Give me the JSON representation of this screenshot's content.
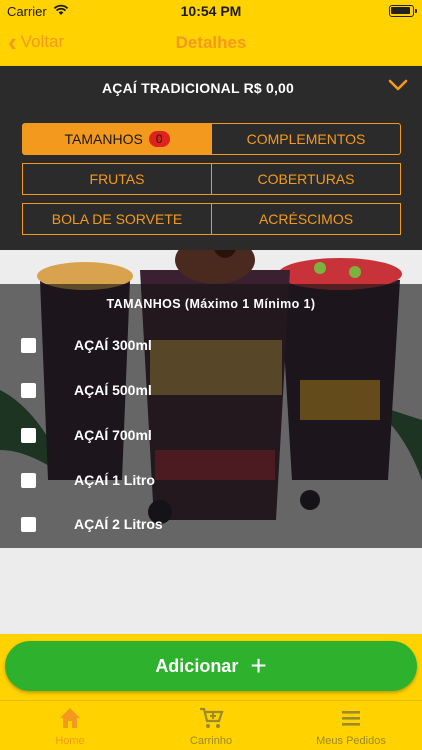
{
  "status": {
    "carrier": "Carrier",
    "time": "10:54 PM"
  },
  "nav": {
    "back_label": "Voltar",
    "title": "Detalhes"
  },
  "product": {
    "name": "AÇAÍ TRADICIONAL R$ 0,00"
  },
  "tabs": {
    "tamanhos": "TAMANHOS",
    "tamanhos_badge": "0",
    "complementos": "COMPLEMENTOS",
    "frutas": "FRUTAS",
    "coberturas": "COBERTURAS",
    "bola_de_sorvete": "BOLA DE SORVETE",
    "acrescimos": "ACRÉSCIMOS"
  },
  "options": {
    "header": "TAMANHOS (Máximo 1 Mínimo 1)",
    "items": [
      {
        "label": "AÇAÍ 300ml",
        "checked": false
      },
      {
        "label": "AÇAÍ 500ml",
        "checked": false
      },
      {
        "label": "AÇAÍ 700ml",
        "checked": false
      },
      {
        "label": "AÇAÍ 1 Litro",
        "checked": false
      },
      {
        "label": "AÇAÍ 2 Litros",
        "checked": false
      }
    ]
  },
  "add_button": {
    "label": "Adicionar",
    "icon": "plus-icon"
  },
  "tabbar": {
    "home": "Home",
    "cart": "Carrinho",
    "orders": "Meus Pedidos"
  },
  "colors": {
    "background": "#ffd200",
    "accent": "#f39a1e",
    "dark": "#2b2b2b",
    "add_button": "#2eb22e",
    "badge": "#e0221c"
  }
}
